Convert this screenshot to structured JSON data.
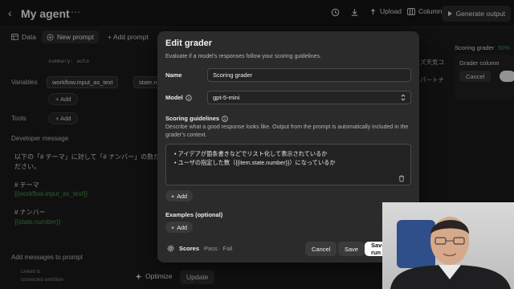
{
  "app": {
    "title": "My agent",
    "back_glyph": "‹",
    "more_glyph": "⋯",
    "actions": {
      "upload_label": "Upload",
      "columns_label": "Columns",
      "generate_label": "Generate output"
    }
  },
  "tabs": [
    {
      "label": "Data",
      "icon": "table-icon"
    },
    {
      "label": "New prompt",
      "icon": "sparkle-icon"
    },
    {
      "label": "+ Add prompt",
      "icon": ""
    }
  ],
  "editor": {
    "partial_line": "summary: auto",
    "variables_label": "Variables",
    "variable_chips": [
      "workflow.input_as_text",
      "state.nu"
    ],
    "add_label": "+ Add",
    "tools_label": "Tools",
    "developer_message_label": "Developer message",
    "message_lines": [
      "以下の「# テーマ」に対して「# ナンバー」の数だけアイ",
      "ださい。",
      "",
      "# テーマ",
      "{{workflow.input_as_text}}",
      "",
      "# ナンバー",
      "{{state.number}}"
    ],
    "add_messages_label": "Add messages to prompt",
    "footer_hint_1": "Linked to",
    "footer_hint_2": "connected workflow",
    "optimize_label": "Optimize",
    "update_label": "Update"
  },
  "right_panel": {
    "scoring_grader_label": "Scoring grader",
    "scoring_pct": "50%",
    "peek_text_1": "ズ天気コ",
    "peek_text_2": "パートナ",
    "grader_column_label": "Grader column",
    "cancel_label": "Cancel"
  },
  "modal": {
    "title": "Edit grader",
    "description": "Evaluate if a model's responses follow your scoring guidelines.",
    "name_label": "Name",
    "name_value": "Scoring grader",
    "model_label": "Model",
    "model_value": "gpt-5-mini",
    "guidelines_label": "Scoring guidelines",
    "guidelines_desc_1": "Describe what a good response looks like. Output from the prompt is automatically included in the",
    "guidelines_desc_2": "grader's context.",
    "guidelines_lines": [
      "• アイデアが箇条書きなどでリスト化して表示されているか",
      "• ユーザの指定した数（{{item.state.number}}）になっているか"
    ],
    "add_label": "Add",
    "examples_label": "Examples (optional)",
    "scores_label": "Scores",
    "scores_values": "Pass · Fail",
    "cancel_label": "Cancel",
    "save_label": "Save",
    "save_and_run_label": "Save and run"
  },
  "colors": {
    "background": "#1a1a1a",
    "modal": "#2b2b2b",
    "accent_green": "#3f9a52",
    "primary_button": "#ffffff"
  }
}
